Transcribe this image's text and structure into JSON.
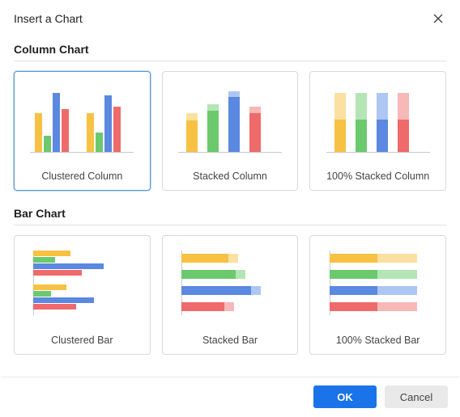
{
  "dialog": {
    "title": "Insert a Chart",
    "close_aria": "Close"
  },
  "sections": [
    {
      "title": "Column Chart"
    },
    {
      "title": "Bar Chart"
    }
  ],
  "column_cards": {
    "clustered": "Clustered Column",
    "stacked": "Stacked Column",
    "pct_stacked": "100% Stacked Column"
  },
  "bar_cards": {
    "clustered": "Clustered Bar",
    "stacked": "Stacked Bar",
    "pct_stacked": "100% Stacked Bar"
  },
  "footer": {
    "ok": "OK",
    "cancel": "Cancel"
  },
  "palette": {
    "yellow": "#f7c143",
    "green": "#6cc96e",
    "blue": "#5b88e0",
    "red": "#ef6a6a"
  }
}
